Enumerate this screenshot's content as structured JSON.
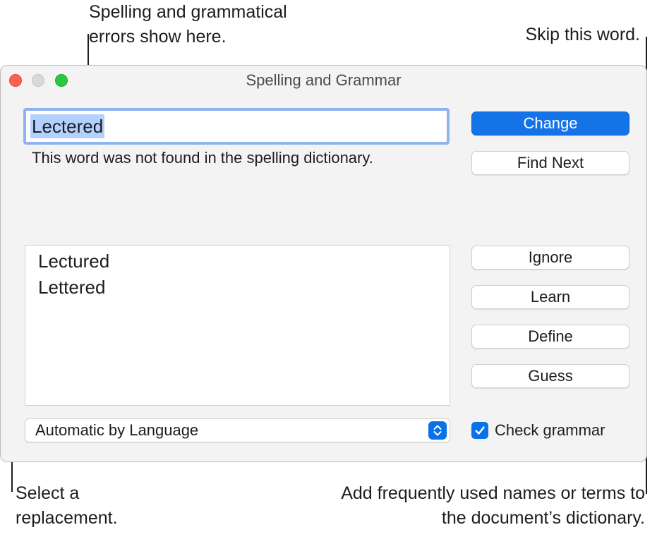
{
  "callouts": {
    "errors_line1": "Spelling and grammatical",
    "errors_line2": "errors show here.",
    "skip": "Skip this word.",
    "replacement_line1": "Select a",
    "replacement_line2": "replacement.",
    "add_line1": "Add frequently used names or terms to",
    "add_line2": "the document’s dictionary."
  },
  "window": {
    "title": "Spelling and Grammar",
    "word": "Lectered",
    "message": "This word was not found in the spelling dictionary.",
    "suggestions": [
      "Lectured",
      "Lettered"
    ],
    "language": "Automatic by Language",
    "check_grammar_label": "Check grammar",
    "check_grammar_checked": true
  },
  "buttons": {
    "change": "Change",
    "find_next": "Find Next",
    "ignore": "Ignore",
    "learn": "Learn",
    "define": "Define",
    "guess": "Guess"
  },
  "colors": {
    "accent": "#1473e6",
    "close": "#fe5f57",
    "zoom": "#28c840"
  }
}
